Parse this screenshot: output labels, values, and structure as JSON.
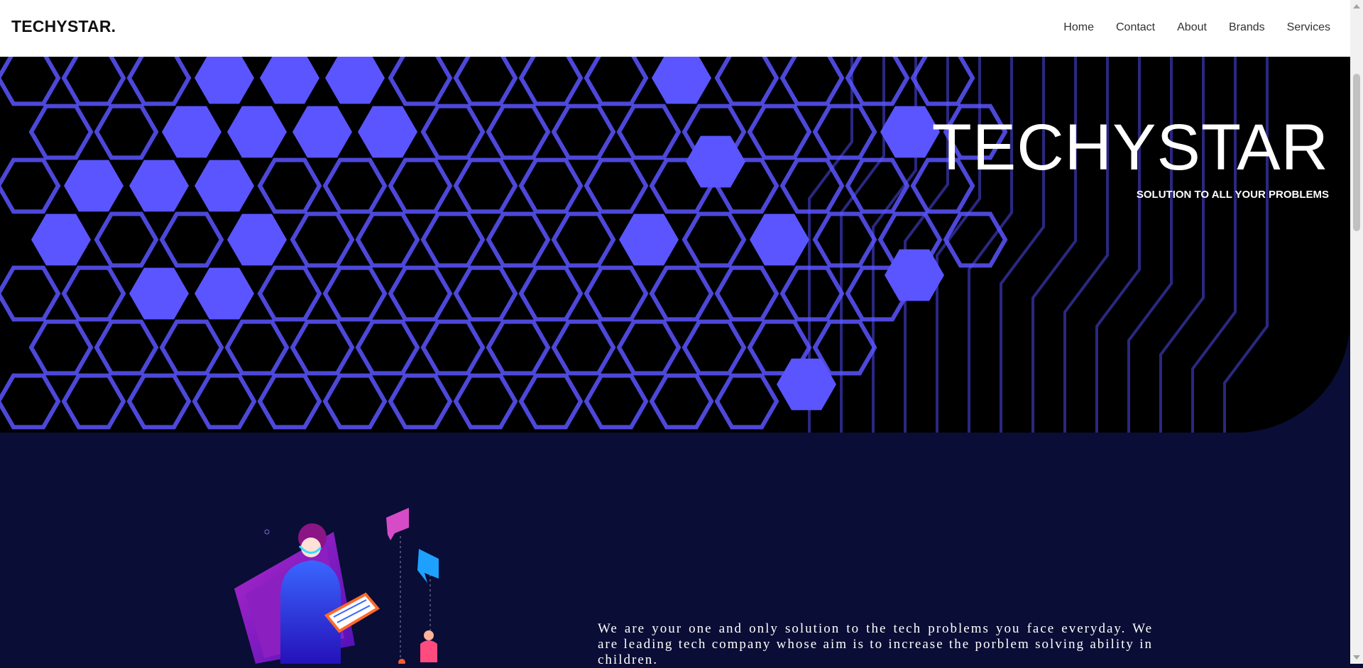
{
  "navbar": {
    "brand": "TECHYSTAR.",
    "links": [
      "Home",
      "Contact",
      "About",
      "Brands",
      "Services"
    ]
  },
  "hero": {
    "title": "TECHYSTAR",
    "subtitle": "SOLUTION TO ALL YOUR PROBLEMS"
  },
  "about": {
    "text": "We are your one and only solution to the tech problems you face everyday. We are leading tech company whose aim is to increase the porblem solving ability in children."
  },
  "colors": {
    "accent": "#5a55ff",
    "background": "#0a0d35",
    "hero": "#000000"
  },
  "icons": [
    "support-agent-illustration",
    "chat-bubble-icon"
  ]
}
